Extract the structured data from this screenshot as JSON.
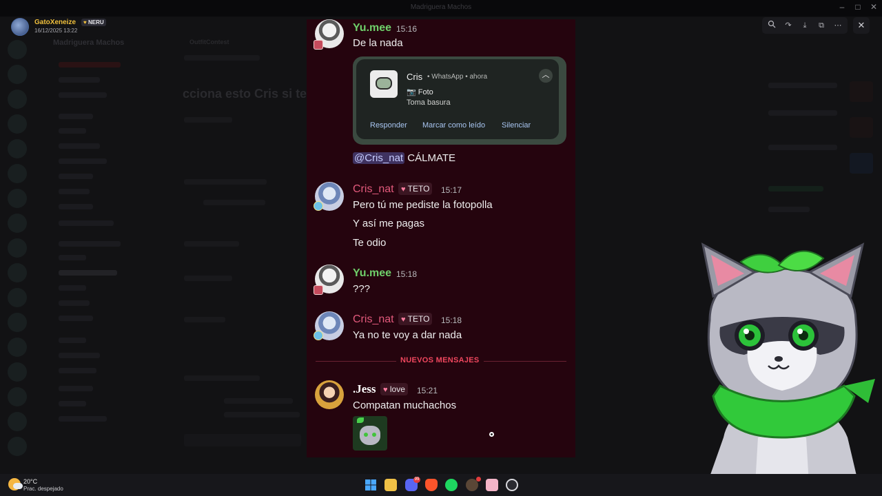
{
  "background": {
    "server_name": "Madriguera Machos",
    "channel_header": "OutfitContest",
    "faded_heading": "cciona esto Cris si te"
  },
  "viewer": {
    "title": "Madriguera Machos",
    "uploader_name": "GatoXeneize",
    "uploader_tag": "NERU",
    "uploader_date": "16/12/2025 13:22",
    "icons": [
      "zoom-icon",
      "forward-icon",
      "download-icon",
      "open-external-icon",
      "more-icon",
      "close-icon"
    ]
  },
  "messages": [
    {
      "id": "m1",
      "author": "Yu.mee",
      "time": "15:16",
      "lines": [
        "De la nada"
      ]
    },
    {
      "id": "m2",
      "mention": "@Cris_nat",
      "text": "CÁLMATE"
    },
    {
      "id": "m3",
      "author": "Cris_nat",
      "role": "TETO",
      "time": "15:17",
      "lines": [
        "Pero tú me pediste la fotopolla",
        "Y así me pagas",
        "Te odio"
      ]
    },
    {
      "id": "m4",
      "author": "Yu.mee",
      "time": "15:18",
      "lines": [
        "???"
      ]
    },
    {
      "id": "m5",
      "author": "Cris_nat",
      "role": "TETO",
      "time": "15:18",
      "lines": [
        "Ya no te voy a dar nada"
      ]
    },
    {
      "id": "m6",
      "author": ".Jess",
      "role": "love",
      "time": "15:21",
      "lines": [
        "Compatan muchachos"
      ]
    }
  ],
  "notification": {
    "sender": "Cris",
    "app": "WhatsApp",
    "when": "ahora",
    "line1": "📷 Foto",
    "line2": "Toma basura",
    "actions": [
      "Responder",
      "Marcar como leído",
      "Silenciar"
    ]
  },
  "divider_label": "NUEVOS MENSAJES",
  "taskbar": {
    "temperature": "20°C",
    "condition": "Prac. despejado",
    "discord_badge": "99"
  },
  "colors": {
    "panel_bg": "#25040e",
    "yumee_name": "#6fcf6a",
    "cris_name": "#e35a7c",
    "divider": "#f0475e",
    "link": "#a9c6f2"
  }
}
